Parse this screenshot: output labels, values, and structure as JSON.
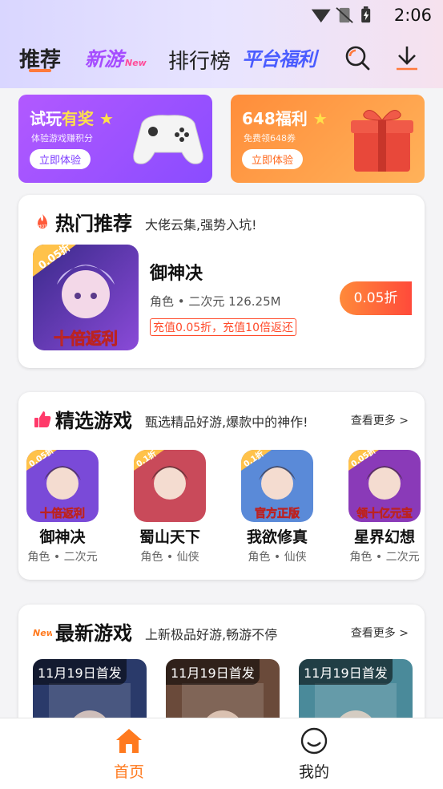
{
  "status": {
    "time": "2:06"
  },
  "nav": {
    "tab_recommend": "推荐",
    "logo_new_games": "新游",
    "logo_new_games_badge": "New",
    "tab_ranking": "排行榜",
    "logo_platform_welfare": "平台福利",
    "search_icon": "search-icon",
    "download_icon": "download-icon"
  },
  "banners": {
    "trial": {
      "title_a": "试玩",
      "title_b": "有奖",
      "subtitle": "体验游戏赚积分",
      "button": "立即体验"
    },
    "welfare": {
      "title": "648福利",
      "subtitle": "免费领648券",
      "button": "立即体验"
    }
  },
  "hot": {
    "title": "热门推荐",
    "subtitle": "大佬云集,强势入坑!",
    "game": {
      "name": "御神决",
      "meta": "角色 • 二次元 126.25M",
      "tag": "充值0.05折，充值10倍返还",
      "button": "0.05折",
      "cover_badge": "0.05折",
      "cover_caption": "十倍返利"
    }
  },
  "picks": {
    "title": "精选游戏",
    "subtitle": "甄选精品好游,爆款中的神作!",
    "more": "查看更多 >",
    "games": [
      {
        "name": "御神决",
        "meta": "角色 • 二次元",
        "badge": "0.05折",
        "caption": "十倍返利",
        "bg": "#7a4ad8"
      },
      {
        "name": "蜀山天下",
        "meta": "角色 • 仙侠",
        "badge": "0.1折",
        "caption": "",
        "bg": "#c94a5a"
      },
      {
        "name": "我欲修真",
        "meta": "角色 • 仙侠",
        "badge": "0.1折",
        "caption": "官方正版",
        "bg": "#5a8ad8"
      },
      {
        "name": "星界幻想",
        "meta": "角色 • 二次元",
        "badge": "0.05折",
        "caption": "领十亿元宝",
        "bg": "#8a3ab8"
      }
    ]
  },
  "newest": {
    "title": "最新游戏",
    "subtitle": "上新极品好游,畅游不停",
    "more": "查看更多 >",
    "games": [
      {
        "label": "11月19日首发",
        "bg": "#2a3a6a"
      },
      {
        "label": "11月19日首发",
        "bg": "#6a4a3a"
      },
      {
        "label": "11月19日首发",
        "bg": "#4a8a9a"
      }
    ]
  },
  "tabbar": {
    "home": "首页",
    "me": "我的"
  },
  "colors": {
    "accent": "#ff7a1f",
    "purple": "#8a4cff"
  }
}
